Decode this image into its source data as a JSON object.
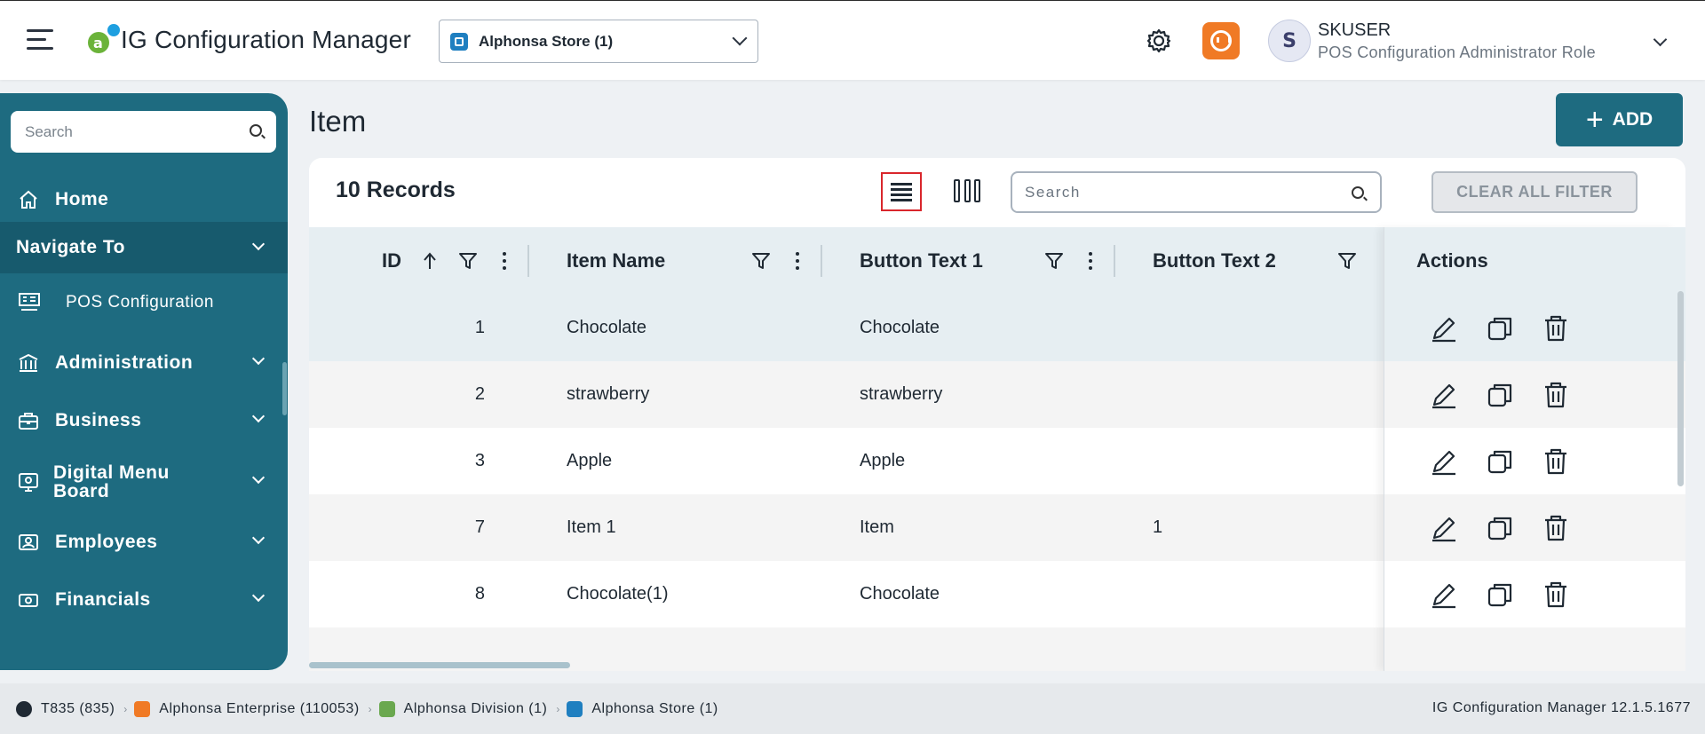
{
  "header": {
    "app_title": "IG Configuration Manager",
    "store_selected": "Alphonsa Store (1)",
    "user_initial": "S",
    "user_name": "SKUSER",
    "user_role": "POS Configuration Administrator Role"
  },
  "sidebar": {
    "search_placeholder": "Search",
    "home_label": "Home",
    "navigate_label": "Navigate To",
    "items": [
      {
        "label": "POS Configuration",
        "icon": "pos-icon"
      },
      {
        "label": "Administration",
        "icon": "building-icon"
      },
      {
        "label": "Business",
        "icon": "briefcase-icon"
      },
      {
        "label": "Digital Menu\nBoard",
        "icon": "monitor-icon"
      },
      {
        "label": "Employees",
        "icon": "id-card-icon"
      },
      {
        "label": "Financials",
        "icon": "money-icon"
      }
    ]
  },
  "main": {
    "page_title": "Item",
    "add_label": "ADD",
    "records_label": "10 Records",
    "search_placeholder": "Search",
    "clear_filter_label": "CLEAR ALL FILTER",
    "columns": {
      "id": "ID",
      "item_name": "Item Name",
      "button_text_1": "Button Text 1",
      "button_text_2": "Button Text 2",
      "actions": "Actions"
    },
    "rows": [
      {
        "id": "1",
        "item_name": "Chocolate",
        "button_text_1": "Chocolate",
        "button_text_2": ""
      },
      {
        "id": "2",
        "item_name": "strawberry",
        "button_text_1": "strawberry",
        "button_text_2": ""
      },
      {
        "id": "3",
        "item_name": "Apple",
        "button_text_1": "Apple",
        "button_text_2": ""
      },
      {
        "id": "7",
        "item_name": "Item 1",
        "button_text_1": "Item",
        "button_text_2": "1"
      },
      {
        "id": "8",
        "item_name": "Chocolate(1)",
        "button_text_1": "Chocolate",
        "button_text_2": ""
      }
    ]
  },
  "footer": {
    "crumbs": [
      {
        "label": "T835 (835)",
        "color": "#1f2933"
      },
      {
        "label": "Alphonsa Enterprise (110053)",
        "color": "#f07a25"
      },
      {
        "label": "Alphonsa Division (1)",
        "color": "#6aa84f"
      },
      {
        "label": "Alphonsa Store (1)",
        "color": "#1f7fc0"
      }
    ],
    "version": "IG Configuration Manager 12.1.5.1677"
  },
  "colors": {
    "primary": "#1e6b80",
    "sidebar_active": "#175a6d",
    "accent_orange": "#f07a25",
    "selected_view_border": "#d9262c"
  }
}
